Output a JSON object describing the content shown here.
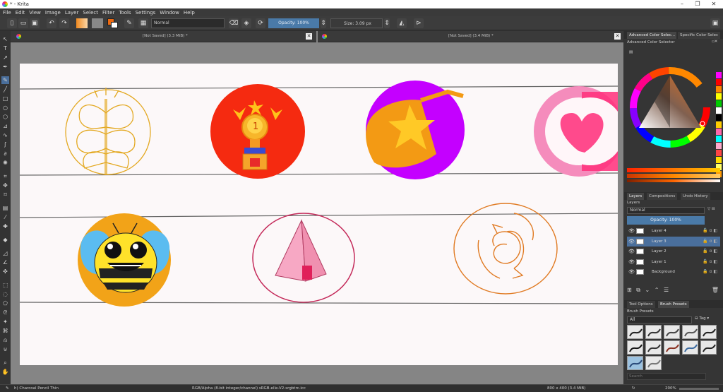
{
  "window": {
    "title": "* - Krita"
  },
  "menu": [
    "File",
    "Edit",
    "View",
    "Image",
    "Layer",
    "Select",
    "Filter",
    "Tools",
    "Settings",
    "Window",
    "Help"
  ],
  "toolbar": {
    "blend_mode": "Normal",
    "opacity": "Opacity: 100%",
    "size": "Size: 3.09 px"
  },
  "documents": [
    {
      "label": "[Not Saved]  (3.3 MiB) *"
    },
    {
      "label": "[Not Saved]  (3.4 MiB) *"
    }
  ],
  "color_dock": {
    "tabs": [
      "Advanced Color Selec...",
      "Specific Color Selec"
    ],
    "title": "Advanced Color Selector"
  },
  "palette": [
    "#ff00ff",
    "#ff0000",
    "#ff8800",
    "#ffff00",
    "#00cc00",
    "#ffffff",
    "#000000",
    "#ffcc00",
    "#ff66aa",
    "#00ffff",
    "#ffaacc",
    "#ff4444",
    "#ffdd00",
    "#ffff66",
    "#ff9900"
  ],
  "layers_dock": {
    "tabs": [
      "Layers",
      "Compositions",
      "Undo History"
    ],
    "title": "Layers",
    "blend_mode": "Normal",
    "opacity": "Opacity: 100%",
    "layers": [
      "Layer 4",
      "Layer 3",
      "Layer 2",
      "Layer 1",
      "Background"
    ],
    "selected_index": 1
  },
  "brush_dock": {
    "tabs": [
      "Tool Options",
      "Brush Presets"
    ],
    "title": "Brush Presets",
    "filter": "All",
    "tag": "Tag",
    "search_placeholder": "Search"
  },
  "status": {
    "brush": "h) Charcoal Pencil Thin",
    "color_space": "RGB/Alpha (8-bit integer/channel)  sRGB-elle-V2-srgbtrc.icc",
    "dimensions": "800 x 400 (3.4 MiB)",
    "zoom": "200%"
  },
  "colors": {
    "accent": "#4a7aa8",
    "trophy_bg": "#f52a10",
    "star_bg": "#c400ff",
    "bee_bg": "#f2a318"
  }
}
